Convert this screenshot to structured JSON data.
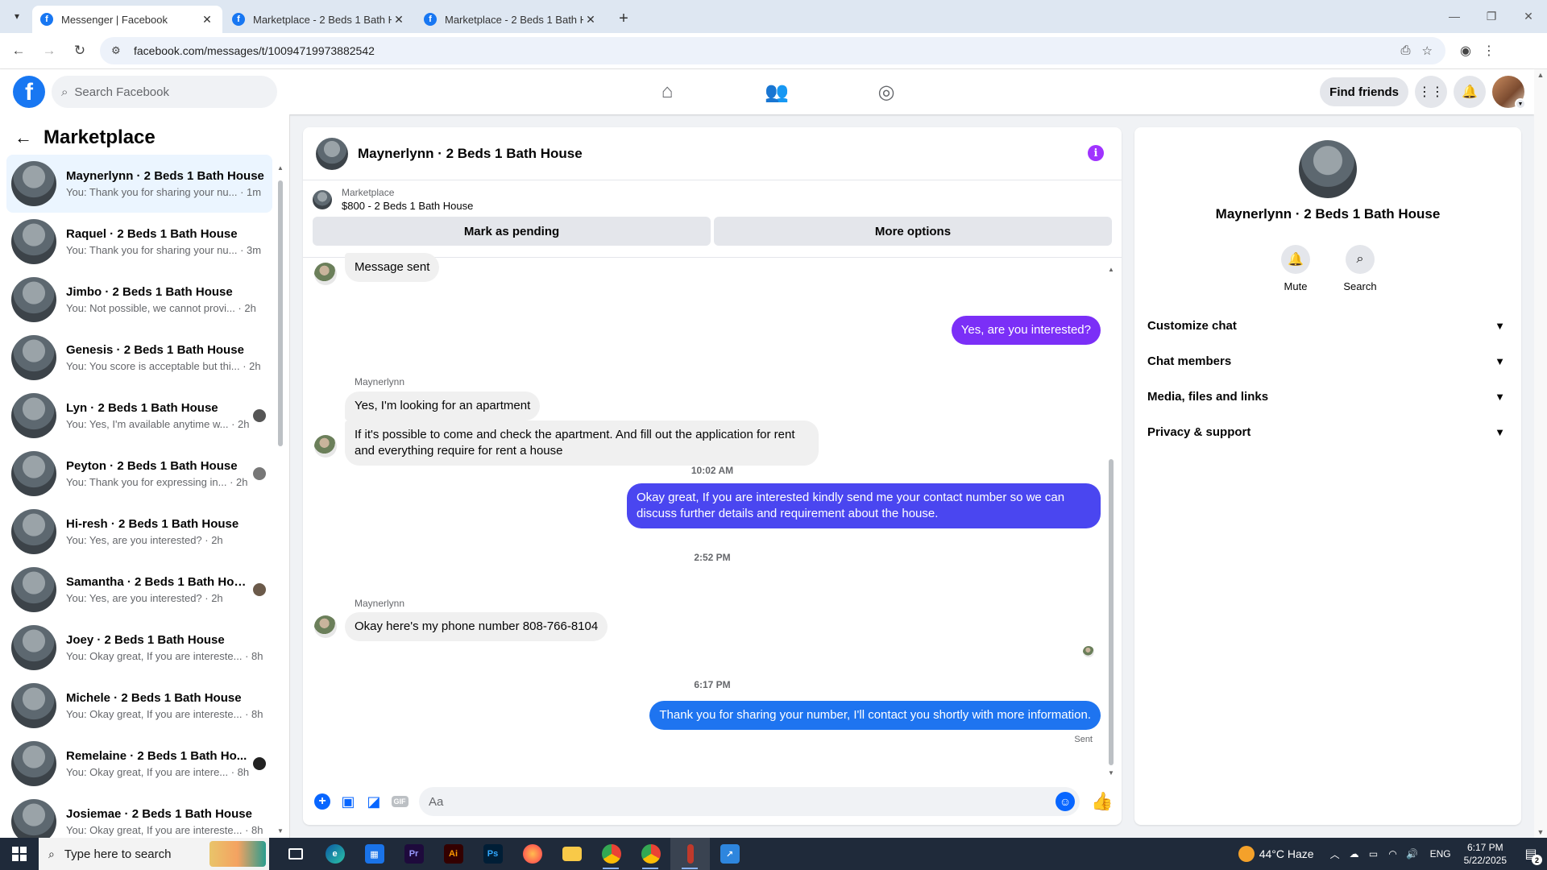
{
  "browser": {
    "tabs": [
      {
        "title": "Messenger | Facebook",
        "active": true
      },
      {
        "title": "Marketplace - 2 Beds 1 Bath Ho",
        "active": false
      },
      {
        "title": "Marketplace - 2 Beds 1 Bath Ho",
        "active": false
      }
    ],
    "url": "facebook.com/messages/t/10094719973882542"
  },
  "fb_header": {
    "search_placeholder": "Search Facebook",
    "find_friends": "Find friends"
  },
  "left_panel": {
    "title": "Marketplace",
    "conversations": [
      {
        "name": "Maynerlynn · 2 Beds 1 Bath House",
        "preview": "You: Thank you for sharing your nu... · 1m"
      },
      {
        "name": "Raquel · 2 Beds 1 Bath House",
        "preview": "You: Thank you for sharing your nu... · 3m"
      },
      {
        "name": "Jimbo · 2 Beds 1 Bath House",
        "preview": "You: Not possible, we cannot provi... · 2h"
      },
      {
        "name": "Genesis · 2 Beds 1 Bath House",
        "preview": "You: You score is acceptable but thi... · 2h"
      },
      {
        "name": "Lyn · 2 Beds 1 Bath House",
        "preview": "You: Yes, I'm available anytime w... · 2h"
      },
      {
        "name": "Peyton · 2 Beds 1 Bath House",
        "preview": "You: Thank you for expressing in... · 2h"
      },
      {
        "name": "Hi-resh · 2 Beds 1 Bath House",
        "preview": "You: Yes, are you interested? · 2h"
      },
      {
        "name": "Samantha · 2 Beds 1 Bath Hou...",
        "preview": "You: Yes, are you interested? · 2h"
      },
      {
        "name": "Joey · 2 Beds 1 Bath House",
        "preview": "You: Okay great, If you are intereste... · 8h"
      },
      {
        "name": "Michele · 2 Beds 1 Bath House",
        "preview": "You: Okay great, If you are intereste... · 8h"
      },
      {
        "name": "Remelaine · 2 Beds 1 Bath Ho...",
        "preview": "You: Okay great, If you are intere... · 8h"
      },
      {
        "name": "Josiemae · 2 Beds 1 Bath House",
        "preview": "You: Okay great, If you are intereste... · 8h"
      }
    ]
  },
  "chat": {
    "title": "Maynerlynn · 2 Beds 1 Bath House",
    "listing_label": "Marketplace",
    "listing_detail": "$800 - 2 Beds 1 Bath House",
    "mark_pending": "Mark as pending",
    "more_options": "More options",
    "messages": {
      "m1": "Message sent",
      "m2": "Yes, are you interested?",
      "sender1": "Maynerlynn",
      "m3": "Yes, I'm looking for an apartment",
      "m4a": "If it's possible to come and check the apartment. And fill out the application for rent",
      "m4b": "and everything require for rent a house",
      "t1": "10:02 AM",
      "m5a": "Okay great, If you are interested kindly send me your contact number so we can",
      "m5b": "discuss further details and requirement about the house.",
      "t2": "2:52 PM",
      "sender2": "Maynerlynn",
      "m6": "Okay here's my phone number 808-766-8104",
      "t3": "6:17 PM",
      "m7": "Thank you for sharing your number, I'll contact you shortly with more information.",
      "status": "Sent"
    },
    "composer_placeholder": "Aa"
  },
  "right_panel": {
    "name": "Maynerlynn · 2 Beds 1 Bath House",
    "mute": "Mute",
    "search": "Search",
    "sections": [
      "Customize chat",
      "Chat members",
      "Media, files and links",
      "Privacy & support"
    ]
  },
  "taskbar": {
    "search_placeholder": "Type here to search",
    "weather": "44°C Haze",
    "lang": "ENG",
    "time": "6:17 PM",
    "date": "5/22/2025",
    "notif_count": "2"
  }
}
